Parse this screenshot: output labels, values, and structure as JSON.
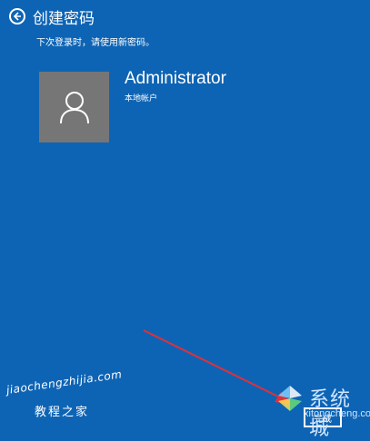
{
  "header": {
    "title": "创建密码"
  },
  "subtitle": "下次登录时，请使用新密码。",
  "user": {
    "name": "Administrator",
    "account_type": "本地帐户"
  },
  "footer": {
    "finish_label": "完成"
  },
  "watermark": {
    "left_url": "jiaochengzhijia.com",
    "left_name": "教程之家",
    "right_brand": "系统城",
    "right_site": "xitongcheng.com"
  },
  "colors": {
    "background": "#0e64b4",
    "avatar_bg": "#767676",
    "arrow": "#e0303a"
  },
  "icons": {
    "back": "back-arrow-icon",
    "user": "user-icon"
  }
}
